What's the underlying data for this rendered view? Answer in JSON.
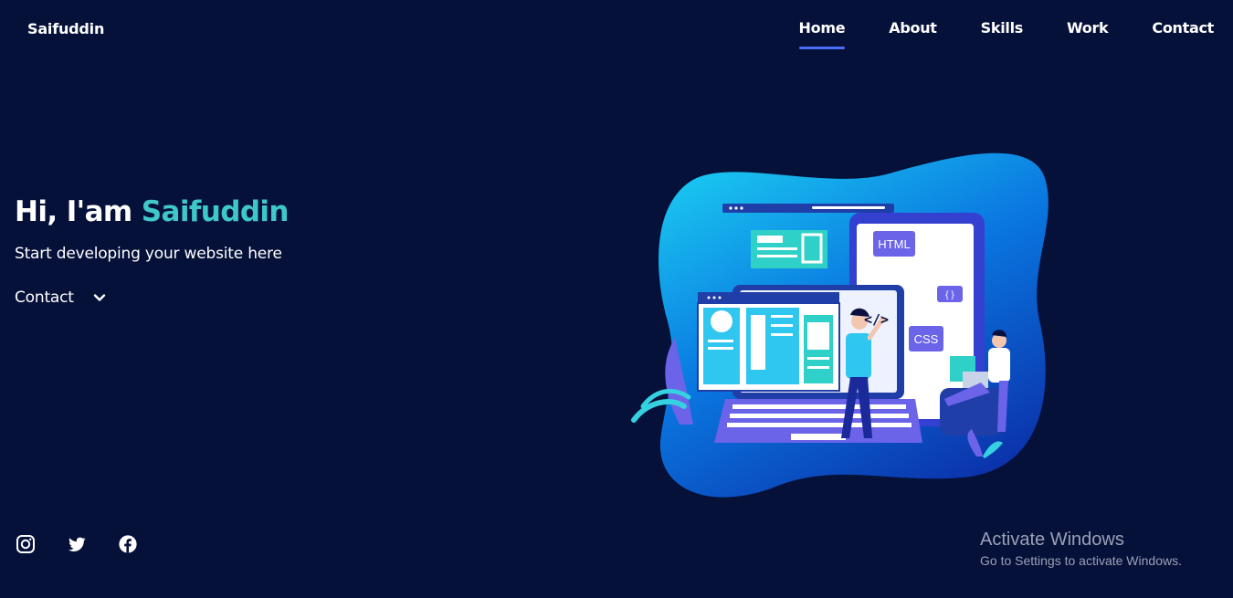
{
  "header": {
    "logo": "Saifuddin",
    "nav": [
      {
        "label": "Home",
        "active": true
      },
      {
        "label": "About",
        "active": false
      },
      {
        "label": "Skills",
        "active": false
      },
      {
        "label": "Work",
        "active": false
      },
      {
        "label": "Contact",
        "active": false
      }
    ]
  },
  "hero": {
    "greeting": "Hi, I'am",
    "name": "Saifuddin",
    "subtitle": "Start developing your website here",
    "contact_label": "Contact"
  },
  "illustration": {
    "html_tag": "HTML",
    "css_tag": "CSS",
    "braces_tag": "{ }",
    "code_tag": "</>"
  },
  "social": [
    {
      "icon": "instagram-icon"
    },
    {
      "icon": "twitter-icon"
    },
    {
      "icon": "facebook-icon"
    }
  ],
  "watermark": {
    "title": "Activate Windows",
    "subtitle": "Go to Settings to activate Windows."
  },
  "colors": {
    "background": "#06113a",
    "accent": "#3ec9c6",
    "nav_underline": "#4a6cf7"
  }
}
